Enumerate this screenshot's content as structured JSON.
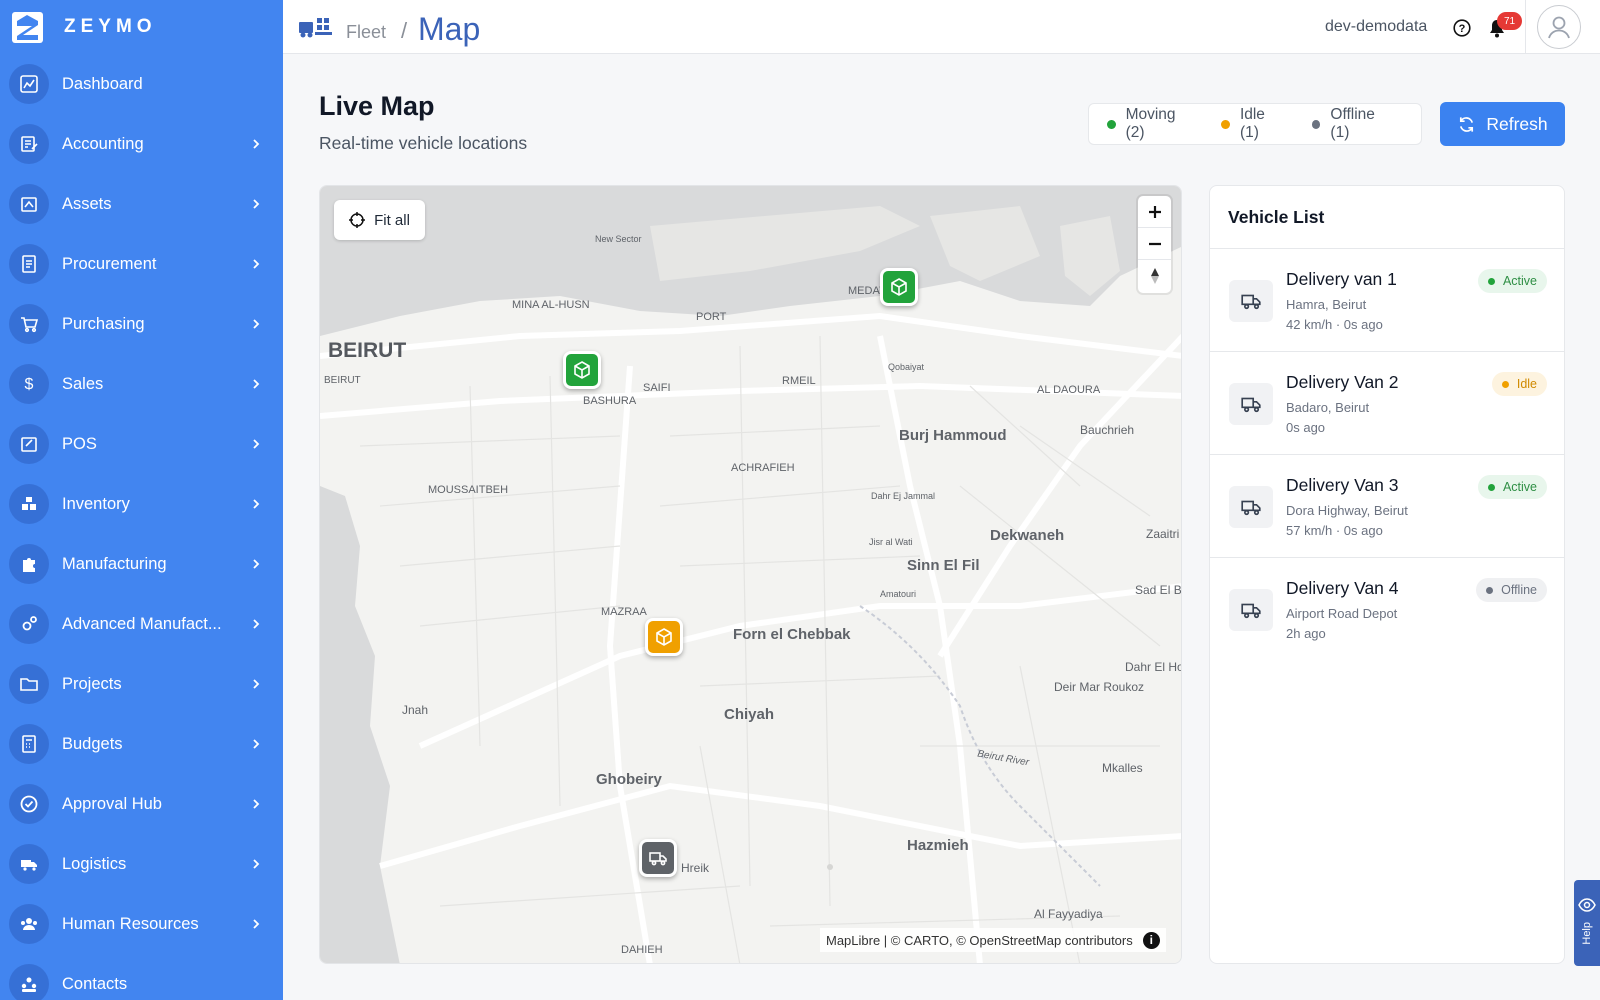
{
  "brand": {
    "name": "ZEYMO"
  },
  "sidebar": {
    "items": [
      {
        "label": "Dashboard",
        "icon": "chart-icon",
        "has_chevron": false
      },
      {
        "label": "Accounting",
        "icon": "ledger-icon",
        "has_chevron": true
      },
      {
        "label": "Assets",
        "icon": "assets-icon",
        "has_chevron": true
      },
      {
        "label": "Procurement",
        "icon": "document-icon",
        "has_chevron": true
      },
      {
        "label": "Purchasing",
        "icon": "cart-icon",
        "has_chevron": true
      },
      {
        "label": "Sales",
        "icon": "dollar-icon",
        "has_chevron": true
      },
      {
        "label": "POS",
        "icon": "pos-icon",
        "has_chevron": true
      },
      {
        "label": "Inventory",
        "icon": "boxes-icon",
        "has_chevron": true
      },
      {
        "label": "Manufacturing",
        "icon": "puzzle-icon",
        "has_chevron": true
      },
      {
        "label": "Advanced Manufact...",
        "icon": "gears-icon",
        "has_chevron": true
      },
      {
        "label": "Projects",
        "icon": "folder-icon",
        "has_chevron": true
      },
      {
        "label": "Budgets",
        "icon": "calculator-icon",
        "has_chevron": true
      },
      {
        "label": "Approval Hub",
        "icon": "check-circle-icon",
        "has_chevron": true
      },
      {
        "label": "Logistics",
        "icon": "truck-icon",
        "has_chevron": true
      },
      {
        "label": "Human Resources",
        "icon": "people-icon",
        "has_chevron": true
      },
      {
        "label": "Contacts",
        "icon": "contacts-icon",
        "has_chevron": false
      }
    ]
  },
  "header": {
    "breadcrumb_parent": "Fleet",
    "breadcrumb_sep": "/",
    "breadcrumb_current": "Map",
    "user": "dev-demodata",
    "notifications_count": "71"
  },
  "page": {
    "title": "Live Map",
    "subtitle": "Real-time vehicle locations"
  },
  "legend": [
    {
      "label": "Moving (2)",
      "color": "#22a33b"
    },
    {
      "label": "Idle (1)",
      "color": "#f0a000"
    },
    {
      "label": "Offline (1)",
      "color": "#6b7280"
    }
  ],
  "refresh_label": "Refresh",
  "map": {
    "fit_all_label": "Fit all",
    "attribution": "MapLibre | © CARTO, © OpenStreetMap contributors",
    "zoom_in": "+",
    "zoom_out": "−",
    "labels": {
      "beirut_big": "BEIRUT",
      "beirut_small": "BEIRUT",
      "new_sector": "New Sector",
      "mina_al_husn": "MINA AL-HUSN",
      "port": "PORT",
      "medawar": "MEDAW...",
      "qobaiyat": "Qobaiyat",
      "saifi": "SAIFI",
      "bashura": "BASHURA",
      "rmeil": "RMEIL",
      "al_daoura": "AL DAOURA",
      "burj_hammoud": "Burj Hammoud",
      "bauchrieh": "Bauchrieh",
      "achrafieh": "ACHRAFIEH",
      "moussaitbeh": "MOUSSAITBEH",
      "dahr_ej_jammal": "Dahr Ej Jammal",
      "jisr_al_wati": "Jisr al Wati",
      "dekwaneh": "Dekwaneh",
      "zaaitri": "Zaaitri",
      "sinn_el_fil": "Sinn El Fil",
      "amatouri": "Amatouri",
      "sad_el_b": "Sad El B",
      "mazraa": "MAZRAA",
      "forn_el_chebbak": "Forn el Chebbak",
      "dahr_el_h": "Dahr El Ho",
      "deir_mar_roukoz": "Deir Mar Roukoz",
      "jnah": "Jnah",
      "chiyah": "Chiyah",
      "beirut_river": "Beirut River",
      "mkalles": "Mkalles",
      "ghobeiry": "Ghobeiry",
      "hazmieh": "Hazmieh",
      "hreik": "Hreik",
      "al_fayyadiya": "Al Fayyadiya",
      "dahieh": "DAHIEH"
    }
  },
  "vehicle_list": {
    "title": "Vehicle List",
    "vehicles": [
      {
        "name": "Delivery van 1",
        "location": "Hamra, Beirut",
        "meta": "42 km/h · 0s ago",
        "status": "Active",
        "status_color": "#22a33b",
        "status_bg": "#e8f6ec",
        "status_text_color": "#2f8f45"
      },
      {
        "name": "Delivery Van 2",
        "location": "Badaro, Beirut",
        "meta": "0s ago",
        "status": "Idle",
        "status_color": "#f0a000",
        "status_bg": "#fdf3df",
        "status_text_color": "#d08a00"
      },
      {
        "name": "Delivery Van 3",
        "location": "Dora Highway, Beirut",
        "meta": "57 km/h · 0s ago",
        "status": "Active",
        "status_color": "#22a33b",
        "status_bg": "#e8f6ec",
        "status_text_color": "#2f8f45"
      },
      {
        "name": "Delivery Van 4",
        "location": "Airport Road Depot",
        "meta": "2h ago",
        "status": "Offline",
        "status_color": "#6b7280",
        "status_bg": "#eff0f2",
        "status_text_color": "#6b7280"
      }
    ]
  },
  "help_tab_label": "Help",
  "colors": {
    "sidebar_bg": "#4285f0",
    "accent": "#3b82f0",
    "moving": "#22a33b",
    "idle": "#f0a000",
    "offline": "#5f6368"
  }
}
